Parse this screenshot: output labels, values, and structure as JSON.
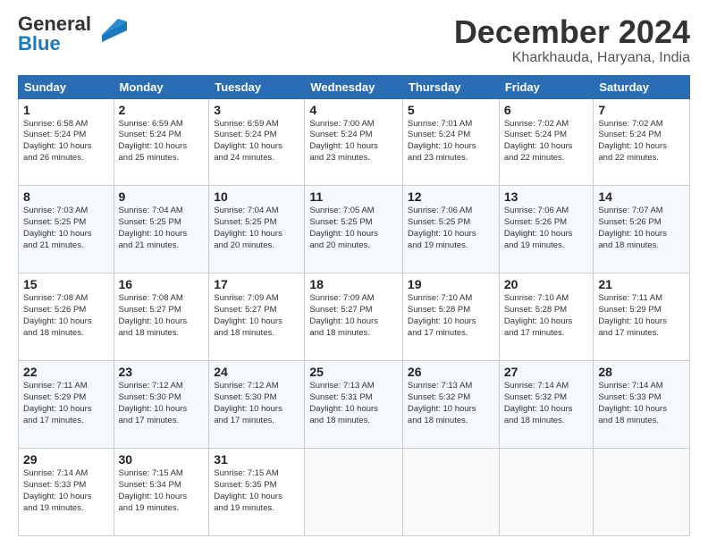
{
  "logo": {
    "line1": "General",
    "line2": "Blue"
  },
  "title": "December 2024",
  "location": "Kharkhauda, Haryana, India",
  "days_of_week": [
    "Sunday",
    "Monday",
    "Tuesday",
    "Wednesday",
    "Thursday",
    "Friday",
    "Saturday"
  ],
  "weeks": [
    [
      {
        "day": "1",
        "info": "Sunrise: 6:58 AM\nSunset: 5:24 PM\nDaylight: 10 hours\nand 26 minutes."
      },
      {
        "day": "2",
        "info": "Sunrise: 6:59 AM\nSunset: 5:24 PM\nDaylight: 10 hours\nand 25 minutes."
      },
      {
        "day": "3",
        "info": "Sunrise: 6:59 AM\nSunset: 5:24 PM\nDaylight: 10 hours\nand 24 minutes."
      },
      {
        "day": "4",
        "info": "Sunrise: 7:00 AM\nSunset: 5:24 PM\nDaylight: 10 hours\nand 23 minutes."
      },
      {
        "day": "5",
        "info": "Sunrise: 7:01 AM\nSunset: 5:24 PM\nDaylight: 10 hours\nand 23 minutes."
      },
      {
        "day": "6",
        "info": "Sunrise: 7:02 AM\nSunset: 5:24 PM\nDaylight: 10 hours\nand 22 minutes."
      },
      {
        "day": "7",
        "info": "Sunrise: 7:02 AM\nSunset: 5:24 PM\nDaylight: 10 hours\nand 22 minutes."
      }
    ],
    [
      {
        "day": "8",
        "info": "Sunrise: 7:03 AM\nSunset: 5:25 PM\nDaylight: 10 hours\nand 21 minutes."
      },
      {
        "day": "9",
        "info": "Sunrise: 7:04 AM\nSunset: 5:25 PM\nDaylight: 10 hours\nand 21 minutes."
      },
      {
        "day": "10",
        "info": "Sunrise: 7:04 AM\nSunset: 5:25 PM\nDaylight: 10 hours\nand 20 minutes."
      },
      {
        "day": "11",
        "info": "Sunrise: 7:05 AM\nSunset: 5:25 PM\nDaylight: 10 hours\nand 20 minutes."
      },
      {
        "day": "12",
        "info": "Sunrise: 7:06 AM\nSunset: 5:25 PM\nDaylight: 10 hours\nand 19 minutes."
      },
      {
        "day": "13",
        "info": "Sunrise: 7:06 AM\nSunset: 5:26 PM\nDaylight: 10 hours\nand 19 minutes."
      },
      {
        "day": "14",
        "info": "Sunrise: 7:07 AM\nSunset: 5:26 PM\nDaylight: 10 hours\nand 18 minutes."
      }
    ],
    [
      {
        "day": "15",
        "info": "Sunrise: 7:08 AM\nSunset: 5:26 PM\nDaylight: 10 hours\nand 18 minutes."
      },
      {
        "day": "16",
        "info": "Sunrise: 7:08 AM\nSunset: 5:27 PM\nDaylight: 10 hours\nand 18 minutes."
      },
      {
        "day": "17",
        "info": "Sunrise: 7:09 AM\nSunset: 5:27 PM\nDaylight: 10 hours\nand 18 minutes."
      },
      {
        "day": "18",
        "info": "Sunrise: 7:09 AM\nSunset: 5:27 PM\nDaylight: 10 hours\nand 18 minutes."
      },
      {
        "day": "19",
        "info": "Sunrise: 7:10 AM\nSunset: 5:28 PM\nDaylight: 10 hours\nand 17 minutes."
      },
      {
        "day": "20",
        "info": "Sunrise: 7:10 AM\nSunset: 5:28 PM\nDaylight: 10 hours\nand 17 minutes."
      },
      {
        "day": "21",
        "info": "Sunrise: 7:11 AM\nSunset: 5:29 PM\nDaylight: 10 hours\nand 17 minutes."
      }
    ],
    [
      {
        "day": "22",
        "info": "Sunrise: 7:11 AM\nSunset: 5:29 PM\nDaylight: 10 hours\nand 17 minutes."
      },
      {
        "day": "23",
        "info": "Sunrise: 7:12 AM\nSunset: 5:30 PM\nDaylight: 10 hours\nand 17 minutes."
      },
      {
        "day": "24",
        "info": "Sunrise: 7:12 AM\nSunset: 5:30 PM\nDaylight: 10 hours\nand 17 minutes."
      },
      {
        "day": "25",
        "info": "Sunrise: 7:13 AM\nSunset: 5:31 PM\nDaylight: 10 hours\nand 18 minutes."
      },
      {
        "day": "26",
        "info": "Sunrise: 7:13 AM\nSunset: 5:32 PM\nDaylight: 10 hours\nand 18 minutes."
      },
      {
        "day": "27",
        "info": "Sunrise: 7:14 AM\nSunset: 5:32 PM\nDaylight: 10 hours\nand 18 minutes."
      },
      {
        "day": "28",
        "info": "Sunrise: 7:14 AM\nSunset: 5:33 PM\nDaylight: 10 hours\nand 18 minutes."
      }
    ],
    [
      {
        "day": "29",
        "info": "Sunrise: 7:14 AM\nSunset: 5:33 PM\nDaylight: 10 hours\nand 19 minutes."
      },
      {
        "day": "30",
        "info": "Sunrise: 7:15 AM\nSunset: 5:34 PM\nDaylight: 10 hours\nand 19 minutes."
      },
      {
        "day": "31",
        "info": "Sunrise: 7:15 AM\nSunset: 5:35 PM\nDaylight: 10 hours\nand 19 minutes."
      },
      {
        "day": "",
        "info": ""
      },
      {
        "day": "",
        "info": ""
      },
      {
        "day": "",
        "info": ""
      },
      {
        "day": "",
        "info": ""
      }
    ]
  ]
}
